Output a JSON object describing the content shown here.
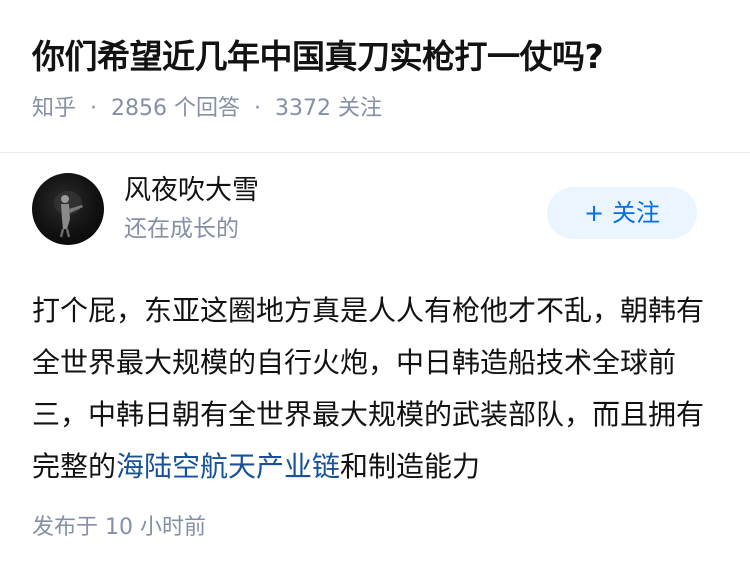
{
  "question": {
    "title": "你们希望近几年中国真刀实枪打一仗吗?",
    "source": "知乎",
    "separator": "·",
    "answer_count": "2856 个回答",
    "follower_count": "3372 关注"
  },
  "answer": {
    "author": {
      "name": "风夜吹大雪",
      "bio": "还在成长的",
      "avatar": "avatar-icon"
    },
    "follow_button": {
      "icon": "+",
      "label": "关注"
    },
    "content": {
      "text_before_link": "打个屁，东亚这圈地方真是人人有枪他才不乱，朝韩有全世界最大规模的自行火炮，中日韩造船技术全球前三，中韩日朝有全世界最大规模的武装部队，而且拥有完整的",
      "link_text": "海陆空航天产业链",
      "text_after_link": "和制造能力"
    },
    "published": "发布于 10 小时前"
  },
  "colors": {
    "meta": "#8590a6",
    "link": "#175199",
    "follow_bg": "#ebf5ff",
    "follow_text": "#056de8"
  }
}
